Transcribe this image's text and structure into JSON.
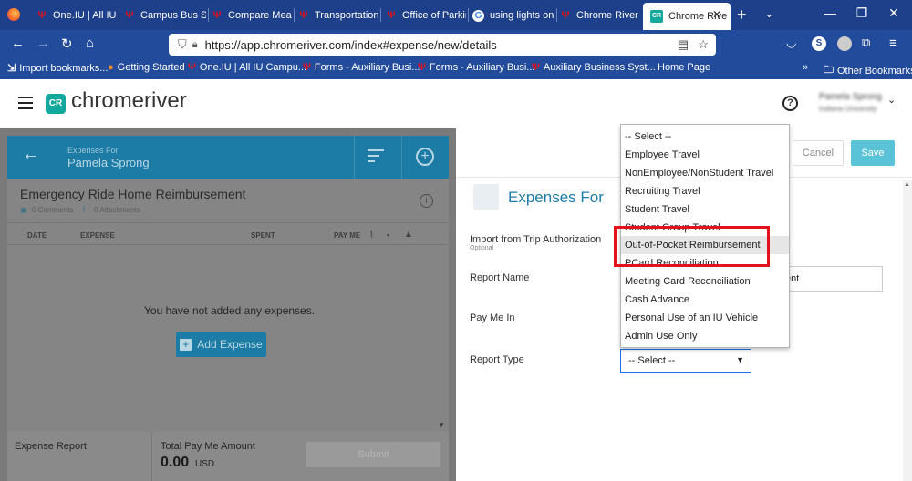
{
  "browser": {
    "tabs": [
      {
        "label": "One.IU | All IU",
        "icon": "iu-trident-icon"
      },
      {
        "label": "Campus Bus Se",
        "icon": "iu-trident-icon"
      },
      {
        "label": "Compare Meal",
        "icon": "iu-trident-icon"
      },
      {
        "label": "Transportation",
        "icon": "iu-trident-icon"
      },
      {
        "label": "Office of Parkin",
        "icon": "iu-trident-icon"
      },
      {
        "label": "using lights on",
        "icon": "google-icon"
      },
      {
        "label": "Chrome River T",
        "icon": "iu-trident-icon"
      },
      {
        "label": "Chrome Rive",
        "icon": "chromeriver-icon"
      }
    ],
    "url": "https://app.chromeriver.com/index#expense/new/details",
    "bookmarks": [
      "Import bookmarks...",
      "Getting Started",
      "One.IU | All IU Campu...",
      "Forms - Auxiliary Busi...",
      "Forms - Auxiliary Busi...",
      "Auxiliary Business Syst...",
      "Home Page"
    ],
    "other_bookmarks": "Other Bookmarks",
    "profile_initial": "S"
  },
  "app": {
    "logo": "chromeriver",
    "logo_mark": "CR",
    "help": "?",
    "user_name": "Pamela Sprong",
    "user_org": "Indiana University"
  },
  "left": {
    "expenses_for_label": "Expenses For",
    "expenses_for_name": "Pamela Sprong",
    "report_title": "Emergency Ride Home Reimbursement",
    "comments": "0 Comments",
    "attachments": "0 Attachments",
    "columns": [
      "DATE",
      "EXPENSE",
      "SPENT",
      "PAY ME"
    ],
    "empty_message": "You have not added any expenses.",
    "add_expense": "Add Expense",
    "footer_label": "Expense Report",
    "total_label": "Total Pay Me Amount",
    "total_value": "0.00",
    "total_currency": "USD",
    "submit": "Submit"
  },
  "right": {
    "cancel": "Cancel",
    "save": "Save",
    "heading": "Expenses For",
    "fields": {
      "import_label": "Import from Trip Authorization",
      "import_optional": "Optional",
      "report_name_label": "Report Name",
      "report_name_value_tail": "ent",
      "pay_me_in_label": "Pay Me In",
      "report_type_label": "Report Type",
      "report_type_value": "-- Select --"
    },
    "dropdown_options": [
      "-- Select --",
      "Employee Travel",
      "NonEmployee/NonStudent Travel",
      "Recruiting Travel",
      "Student Travel",
      "Student Group Travel",
      "Out-of-Pocket Reimbursement",
      "PCard Reconciliation",
      "Meeting Card Reconciliation",
      "Cash Advance",
      "Personal Use of an IU Vehicle",
      "Admin Use Only"
    ],
    "highlighted_option": "Out-of-Pocket Reimbursement",
    "highlight_color": "#e3111b"
  }
}
